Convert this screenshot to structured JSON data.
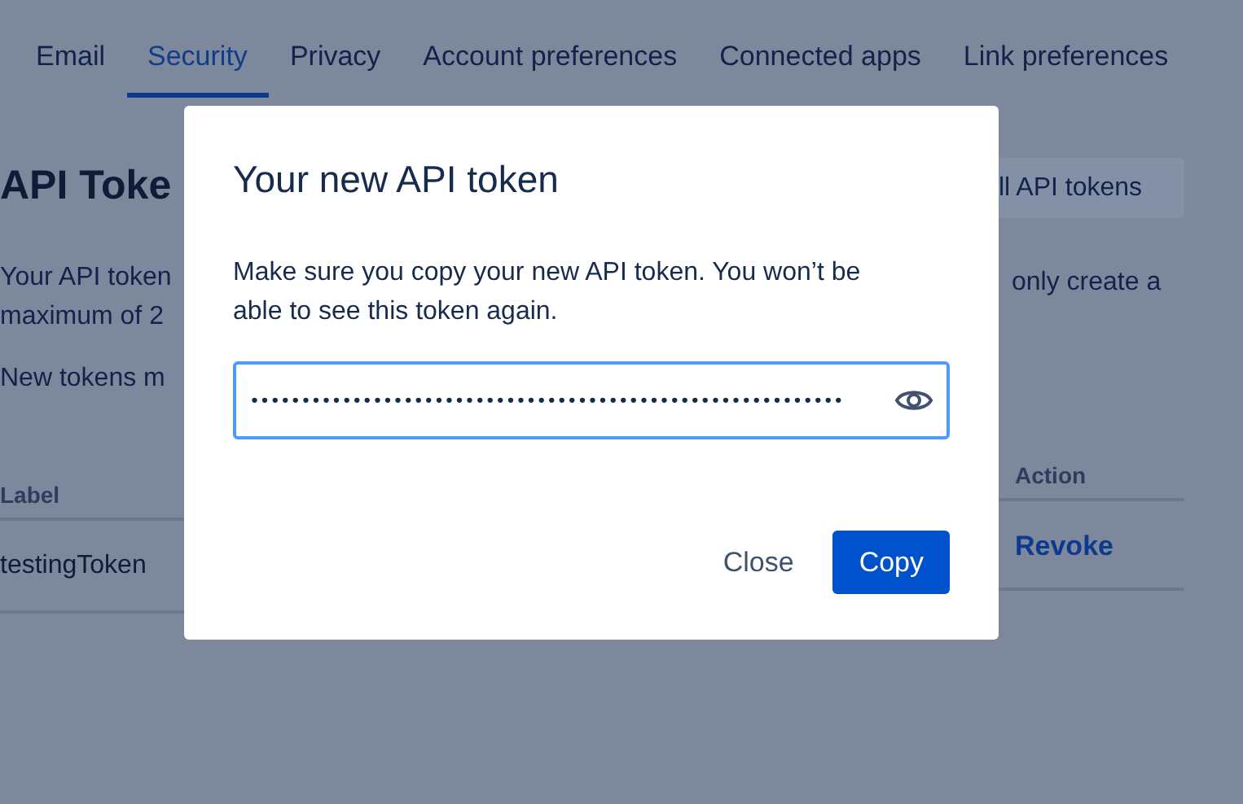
{
  "tabs": [
    {
      "label": "Email",
      "selected": false
    },
    {
      "label": "Security",
      "selected": true
    },
    {
      "label": "Privacy",
      "selected": false
    },
    {
      "label": "Account preferences",
      "selected": false
    },
    {
      "label": "Connected apps",
      "selected": false
    },
    {
      "label": "Link preferences",
      "selected": false
    }
  ],
  "page": {
    "heading": "API Toke",
    "heading_button": "ll API tokens",
    "intro_left": [
      "Your API token",
      "maximum of 2"
    ],
    "intro_right": "only create a",
    "note": "New tokens m",
    "table": {
      "columns": [
        "Label",
        "Action"
      ],
      "rows": [
        {
          "label": "testingToken",
          "action": "Revoke"
        }
      ]
    }
  },
  "dialog": {
    "title": "Your new API token",
    "message": "Make sure you copy your new API token. You won’t be able to see this token again.",
    "token": "••••••••••••••••••••••••••••••••••••••••••••••••••••••••••",
    "buttons": [
      {
        "label": "Close",
        "kind": "subtle"
      },
      {
        "label": "Copy",
        "kind": "primary"
      }
    ]
  }
}
